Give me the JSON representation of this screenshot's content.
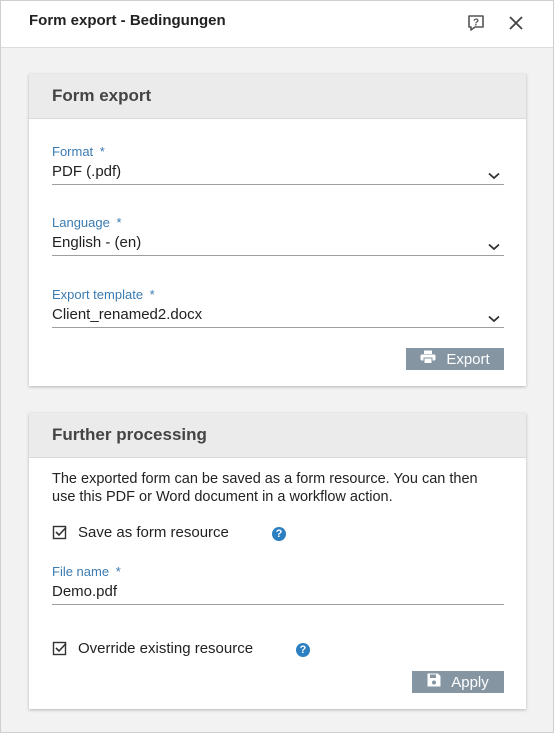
{
  "dialog": {
    "title": "Form export - Bedingungen"
  },
  "form_export": {
    "header": "Form export",
    "format": {
      "label": "Format",
      "required": "*",
      "value": "PDF (.pdf)"
    },
    "language": {
      "label": "Language",
      "required": "*",
      "value": "English - (en)"
    },
    "template": {
      "label": "Export template",
      "required": "*",
      "value": "Client_renamed2.docx"
    },
    "export_button": "Export"
  },
  "further_processing": {
    "header": "Further processing",
    "description_line1": "The exported form can be saved as a form resource. You can then",
    "description_line2": "use this PDF or Word document in a workflow action.",
    "save_as_resource": {
      "label": "Save as form resource",
      "checked": true
    },
    "file_name": {
      "label": "File name",
      "required": "*",
      "value": "Demo.pdf"
    },
    "override": {
      "label": "Override existing resource",
      "checked": true
    },
    "help_glyph": "?",
    "apply_button": "Apply"
  }
}
